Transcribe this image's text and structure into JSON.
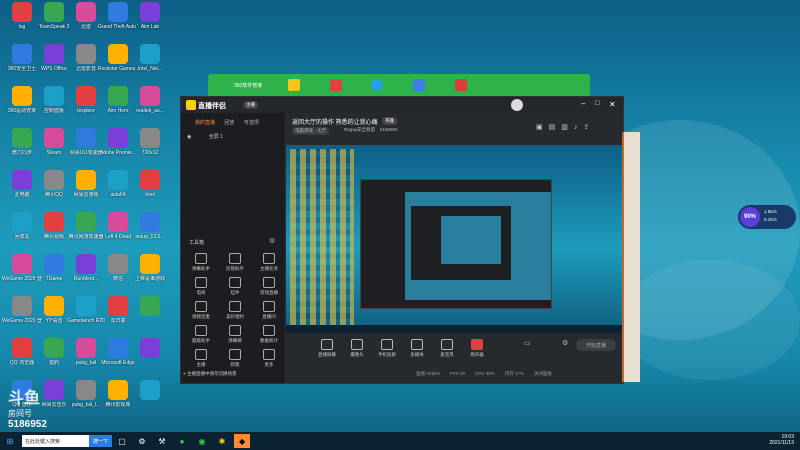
{
  "desktop": {
    "icons_col1": [
      "log",
      "360安全卫士",
      "360驱动管家",
      "微力同步",
      "此电脑",
      "回收站",
      "WeGame 2020 登...",
      "WeGame 2020 登...",
      "QQ 浏览器",
      "QQ 音乐"
    ],
    "icons_col2": [
      "TeamSpeak 3",
      "WPS Office",
      "控制面板",
      "Steam",
      "腾讯QQ",
      "腾讯视频",
      "TGame",
      "YY语音",
      "猎豹",
      "网易云音乐"
    ],
    "icons_col3": [
      "迅雷",
      "迅雷影音",
      "Iexplore",
      "网易UU加速器",
      "网易云游戏",
      "腾讯网游加速器",
      "RunMent...",
      "Gamebench R20",
      "pubg_fail",
      "pubg_fail_l..."
    ],
    "icons_col4": [
      "Grand Theft Auto V",
      "Rockstar Games...",
      "Aim Hero",
      "Adobe Premie...",
      "aida64",
      "Left 4 Dead",
      "微信",
      "向日葵",
      "Microsoft Edge",
      "腾讯影视库"
    ],
    "icons_col5": [
      "Aim Lab",
      "Intel_Net...",
      "realtek_au...",
      "720x12",
      "Intel",
      "setup_13.0...",
      "上帝是谁游戏",
      "",
      "",
      " "
    ]
  },
  "watermark": {
    "title": "斗鱼",
    "subtitle": "房间号",
    "room": "5186952"
  },
  "perf_widget": {
    "percent": "90%",
    "net_up": "1.5K/s",
    "net_down": "0.1K/s"
  },
  "window_360": {
    "title": "360软件管家"
  },
  "app": {
    "name": "直播伴侣",
    "badge": "主播",
    "stream_title": "返回大厅的操作 熟悉的让我心痛",
    "category": "英雄",
    "tag1": "电脑游戏 · 大厅",
    "tag2": "Regay安全联盟",
    "room_id": "5186952",
    "left_tabs": [
      "我的直播",
      "回放",
      "可选项"
    ],
    "scene": "全屏 1",
    "toolbox_title": "工具箱",
    "tools": [
      [
        "弹幕助手",
        "房管助手",
        "主播任务"
      ],
      [
        "电商",
        "挂件",
        "游戏直播"
      ],
      [
        "视频连麦",
        "美好相约",
        "直播间"
      ],
      [
        "超级助手",
        "弹幕精",
        "数据统计"
      ],
      [
        "主播",
        "新版",
        "更多"
      ]
    ],
    "bottom_notice": "主播直播中请勿切换场景",
    "controls": [
      "直播屏幕",
      "摄像头",
      "手机投屏",
      "多媒体",
      "麦克风",
      "扬声器"
    ],
    "start_btn": "开始直播",
    "status_bar": [
      "直播 0Kbit/s",
      "FPS 30",
      "CPU 48%",
      "内存 37%",
      "关闭面板"
    ]
  },
  "taskbar": {
    "search_placeholder": "在此处键入搜索",
    "search_btn": "搜一下",
    "time": "19:03",
    "date": "2021/11/13"
  }
}
